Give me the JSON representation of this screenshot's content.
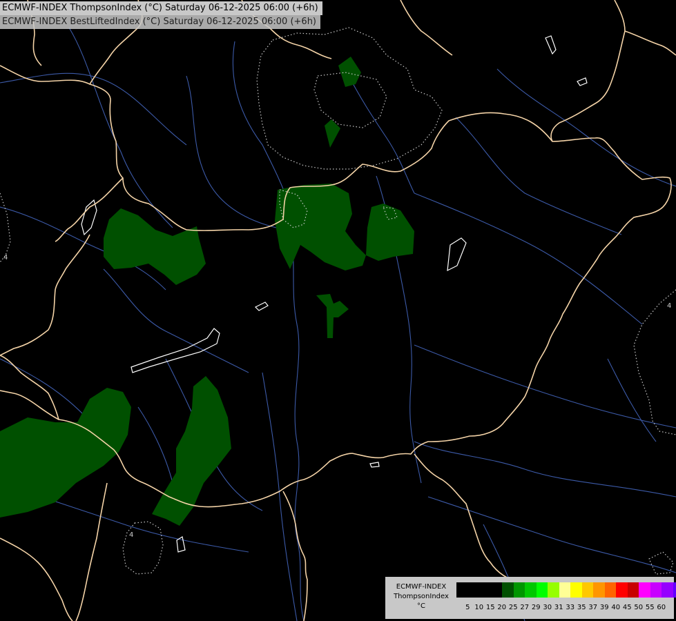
{
  "titles": {
    "line1": "ECMWF-INDEX ThompsonIndex (°C) Saturday 06-12-2025 06:00 (+6h)",
    "line2": "ECMWF-INDEX BestLiftedIndex (°C) Saturday 06-12-2025 06:00 (+6h)"
  },
  "legend": {
    "model": "ECMWF-INDEX",
    "parameter": "ThompsonIndex",
    "unit": "°C",
    "ticks": [
      "5",
      "10",
      "15",
      "20",
      "25",
      "27",
      "29",
      "30",
      "31",
      "33",
      "35",
      "37",
      "39",
      "40",
      "45",
      "50",
      "55",
      "60"
    ],
    "colors": [
      "#000000",
      "#000000",
      "#000000",
      "#000000",
      "#005000",
      "#009600",
      "#00c800",
      "#00ff00",
      "#96ff00",
      "#ffff96",
      "#ffff00",
      "#ffc800",
      "#ff9600",
      "#ff6400",
      "#ff0000",
      "#c80000",
      "#ff00ff",
      "#c800ff",
      "#9600ff",
      "#6400ff",
      "#0000ff"
    ]
  },
  "colors": {
    "background": "#000000",
    "border": "#f5d4a8",
    "river": "#3c5aa8",
    "lake_outline": "#ffffff",
    "index_contour": "#cccccc",
    "thompson_20_25": "#005000"
  },
  "markers": {
    "contour_label_1": "4",
    "contour_label_2": "4",
    "contour_label_3": "4"
  }
}
